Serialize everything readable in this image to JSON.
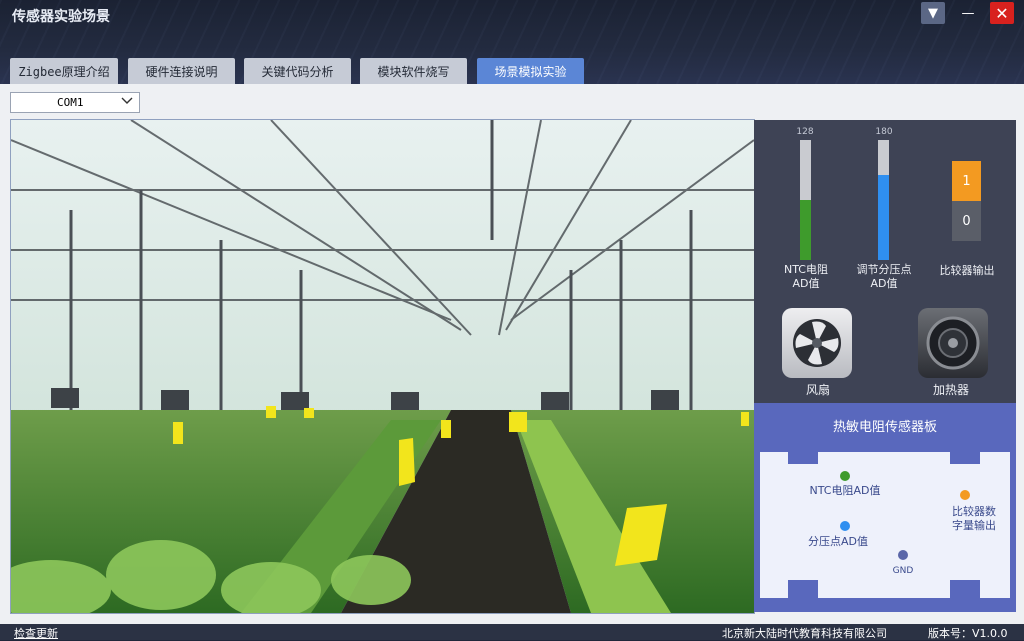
{
  "window": {
    "title": "传感器实验场景",
    "menu_icon": "▼",
    "minimize_icon": "—",
    "close_icon": "✕"
  },
  "tabs": [
    {
      "label": "Zigbee原理介绍",
      "active": false
    },
    {
      "label": "硬件连接说明",
      "active": false
    },
    {
      "label": "关键代码分析",
      "active": false
    },
    {
      "label": "模块软件烧写",
      "active": false
    },
    {
      "label": "场景模拟实验",
      "active": true
    }
  ],
  "port": {
    "selected": "COM1"
  },
  "gauges": [
    {
      "value": "128",
      "label_line1": "NTC电阻",
      "label_line2": "AD值",
      "color": "#3e9b2c",
      "fill_fraction": 0.5
    },
    {
      "value": "180",
      "label_line1": "调节分压点",
      "label_line2": "AD值",
      "color": "#2f8ff0",
      "fill_fraction": 0.71
    }
  ],
  "comparator": {
    "label": "比较器输出",
    "high": "1",
    "low": "0",
    "high_color": "#f39a21",
    "low_color": "#5a5e68"
  },
  "devices": {
    "fan_label": "风扇",
    "heater_label": "加热器"
  },
  "board": {
    "title": "热敏电阻传感器板",
    "pins": {
      "ntc": "NTC电阻AD值",
      "divider": "分压点AD值",
      "gnd": "GND",
      "comparator_line1": "比较器数",
      "comparator_line2": "字量输出"
    }
  },
  "status": {
    "check_update": "检查更新",
    "company": "北京新大陆时代教育科技有限公司",
    "version": "版本号：V1.0.0"
  }
}
